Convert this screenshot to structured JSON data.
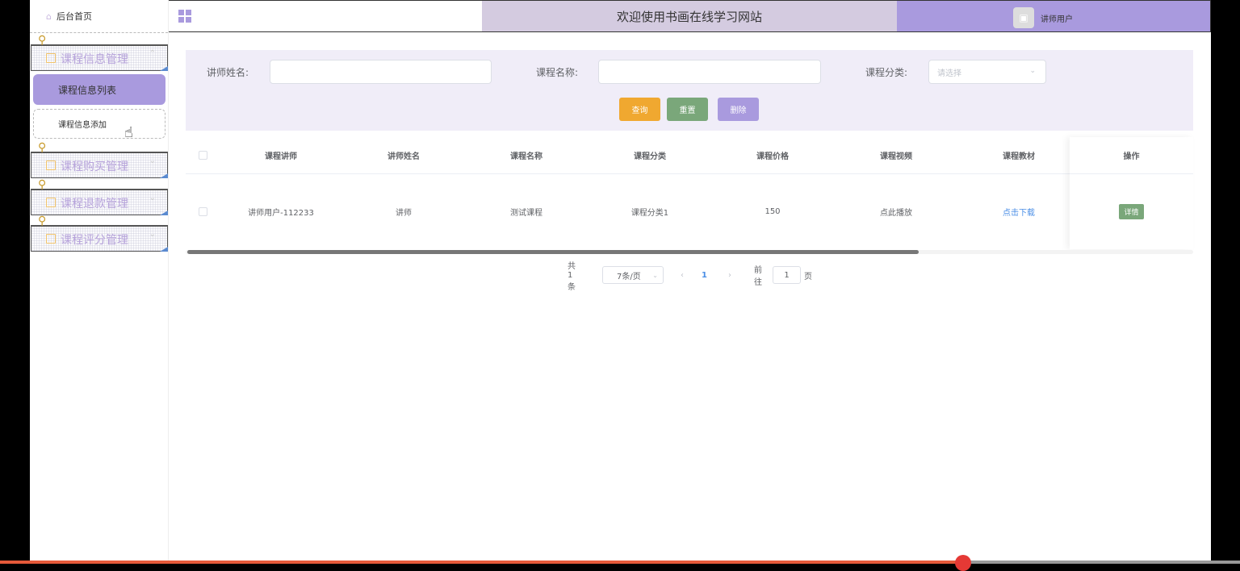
{
  "sidebar": {
    "home": "后台首页",
    "groups": [
      {
        "label": "课程信息管理"
      },
      {
        "label": "课程购买管理"
      },
      {
        "label": "课程退款管理"
      },
      {
        "label": "课程评分管理"
      }
    ],
    "sub_items": [
      "课程信息列表",
      "课程信息添加"
    ]
  },
  "header": {
    "title": "欢迎使用书画在线学习网站",
    "username": "讲师用户"
  },
  "search": {
    "teacher_name_label": "讲师姓名:",
    "course_name_label": "课程名称:",
    "category_label": "课程分类:",
    "category_placeholder": "请选择",
    "query_label": "查询",
    "reset_label": "重置",
    "delete_label": "删除"
  },
  "table": {
    "headers": [
      "课程讲师",
      "讲师姓名",
      "课程名称",
      "课程分类",
      "课程价格",
      "课程视频",
      "课程教材",
      "操作"
    ],
    "rows": [
      {
        "teacher": "讲师用户-112233",
        "teacher_name": "讲师",
        "course_name": "测试课程",
        "category": "课程分类1",
        "price": "150",
        "video": "点此播放",
        "material": "点击下载",
        "action": "详情"
      }
    ]
  },
  "pager": {
    "total": "共 1 条",
    "page_size": "7条/页",
    "prev": "‹",
    "current": "1",
    "next": "›",
    "goto_label": "前往",
    "goto_value": "1",
    "page_suffix": "页"
  },
  "colors": {
    "accent": "#a99ade",
    "header_mid": "#d4cbe0",
    "search_bg": "#f0edf8",
    "query": "#f0a830",
    "reset": "#7aa77a",
    "delete": "#a99ade"
  }
}
